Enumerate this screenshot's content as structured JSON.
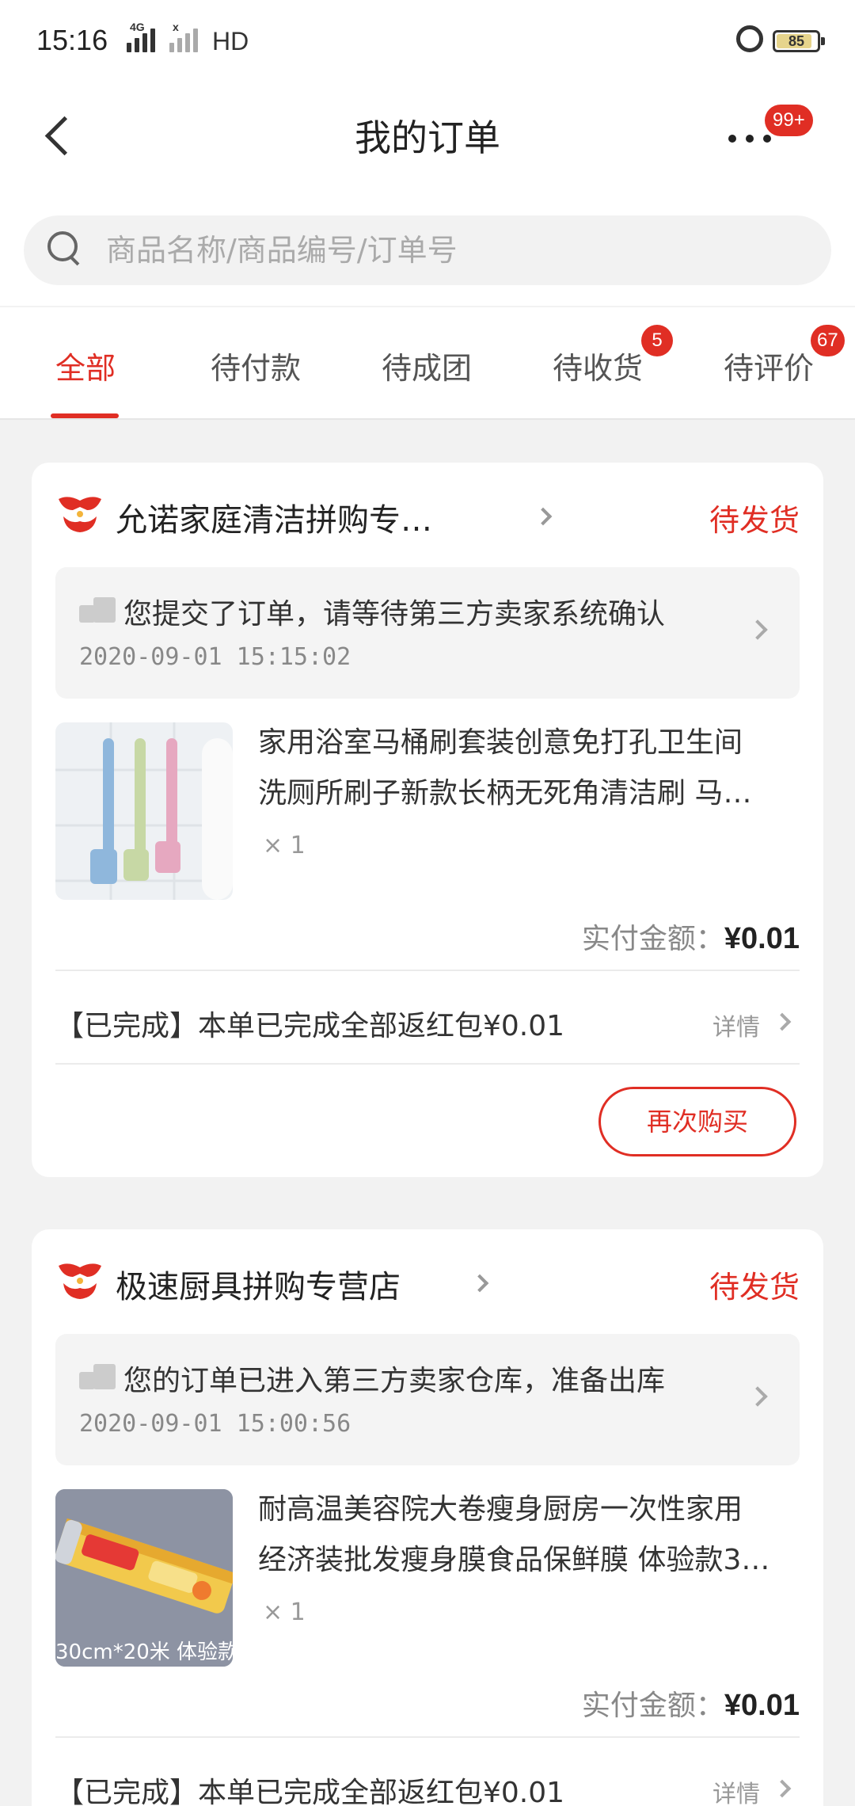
{
  "status_bar": {
    "time": "15:16",
    "network_1": "4G",
    "network_2": "x",
    "hd": "HD",
    "battery": "85",
    "battery_level": 0.85
  },
  "header": {
    "title": "我的订单",
    "badge": "99+"
  },
  "search": {
    "placeholder": "商品名称/商品编号/订单号"
  },
  "tabs": [
    {
      "label": "全部",
      "active": true
    },
    {
      "label": "待付款"
    },
    {
      "label": "待成团"
    },
    {
      "label": "待收货",
      "badge": "5"
    },
    {
      "label": "待评价",
      "badge": "67"
    }
  ],
  "orders": [
    {
      "shop": "允诺家庭清洁拼购专…",
      "status": "待发货",
      "logistics_text": "您提交了订单，请等待第三方卖家系统确认",
      "logistics_time": "2020-09-01 15:15:02",
      "product_line1": "家用浴室马桶刷套装创意免打孔卫生间",
      "product_line2": "洗厕所刷子新款长柄无死角清洁刷 马…",
      "qty": "× 1",
      "price_label": "实付金额：",
      "price": "¥0.01",
      "done_text": "【已完成】本单已完成全部返红包¥0.01",
      "detail": "详情",
      "rebuy": "再次购买"
    },
    {
      "shop": "极速厨具拼购专营店",
      "status": "待发货",
      "logistics_text": "您的订单已进入第三方卖家仓库，准备出库",
      "logistics_time": "2020-09-01 15:00:56",
      "product_line1": "耐高温美容院大卷瘦身厨房一次性家用",
      "product_line2": "经济装批发瘦身膜食品保鲜膜 体验款3…",
      "qty": "× 1",
      "thumb_caption": "30cm*20米 体验款",
      "price_label": "实付金额：",
      "price": "¥0.01",
      "done_text": "【已完成】本单已完成全部返红包¥0.01",
      "detail": "详情"
    }
  ],
  "colors": {
    "accent": "#e02e24",
    "background": "#f2f2f2"
  }
}
